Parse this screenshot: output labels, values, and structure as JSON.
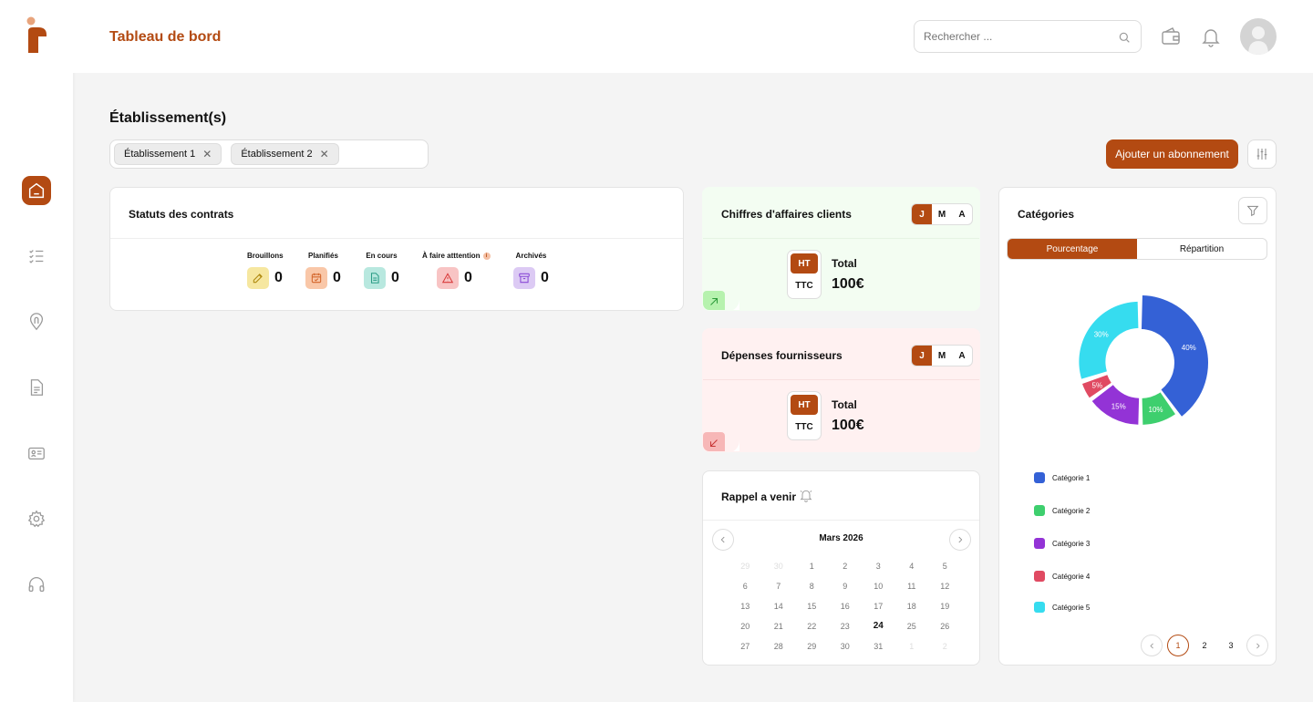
{
  "header": {
    "title": "Tableau de bord",
    "search_placeholder": "Rechercher ..."
  },
  "establishments": {
    "title": "Établissement(s)",
    "chips": [
      {
        "label": "Établissement 1"
      },
      {
        "label": "Établissement 2"
      }
    ]
  },
  "actions": {
    "add_subscription": "Ajouter un abonnement"
  },
  "contract_status": {
    "title": "Statuts des contrats",
    "items": [
      {
        "label": "Brouillons",
        "count": "0",
        "color": "#f6e7a0",
        "icon": "edit-icon"
      },
      {
        "label": "Planifiés",
        "count": "0",
        "color": "#f9c7a8",
        "icon": "calendar-check-icon"
      },
      {
        "label": "En cours",
        "count": "0",
        "color": "#b8e8df",
        "icon": "document-icon"
      },
      {
        "label": "À faire atttention",
        "count": "0",
        "color": "#f8c4c4",
        "icon": "warning-icon"
      },
      {
        "label": "Archivés",
        "count": "0",
        "color": "#dccaf4",
        "icon": "archive-icon"
      }
    ]
  },
  "revenue": {
    "title": "Chiffres d'affaires clients",
    "periods": [
      "J",
      "M",
      "A"
    ],
    "ht": "HT",
    "ttc": "TTC",
    "total_label": "Total",
    "total_value": "100€",
    "bg": "#f3fdf2",
    "accent": "#b6f2ae"
  },
  "expenses": {
    "title": "Dépenses fournisseurs",
    "periods": [
      "J",
      "M",
      "A"
    ],
    "ht": "HT",
    "ttc": "TTC",
    "total_label": "Total",
    "total_value": "100€",
    "bg": "#fff1f1",
    "accent": "#f7b7b7"
  },
  "reminders": {
    "title": "Rappel a venir",
    "month": "Mars 2026",
    "today": "24",
    "days": [
      {
        "d": "29",
        "faded": true
      },
      {
        "d": "30",
        "faded": true
      },
      {
        "d": "1"
      },
      {
        "d": "2"
      },
      {
        "d": "3"
      },
      {
        "d": "4"
      },
      {
        "d": "5"
      },
      {
        "d": "6"
      },
      {
        "d": "7"
      },
      {
        "d": "8"
      },
      {
        "d": "9"
      },
      {
        "d": "10"
      },
      {
        "d": "11"
      },
      {
        "d": "12"
      },
      {
        "d": "13"
      },
      {
        "d": "14"
      },
      {
        "d": "15"
      },
      {
        "d": "16"
      },
      {
        "d": "17"
      },
      {
        "d": "18"
      },
      {
        "d": "19"
      },
      {
        "d": "20"
      },
      {
        "d": "21"
      },
      {
        "d": "22"
      },
      {
        "d": "23"
      },
      {
        "d": "24"
      },
      {
        "d": "25"
      },
      {
        "d": "26"
      },
      {
        "d": "27"
      },
      {
        "d": "28"
      },
      {
        "d": "29"
      },
      {
        "d": "30"
      },
      {
        "d": "31"
      },
      {
        "d": "1",
        "faded": true
      },
      {
        "d": "2",
        "faded": true
      }
    ]
  },
  "categories": {
    "title": "Catégories",
    "tabs": [
      "Pourcentage",
      "Répartition"
    ],
    "pages": [
      "1",
      "2",
      "3"
    ],
    "current_page": "1"
  },
  "chart_data": {
    "type": "pie",
    "variant": "donut",
    "categories": [
      "Catégorie 1",
      "Catégorie 2",
      "Catégorie 3",
      "Catégorie 4",
      "Catégorie 5"
    ],
    "values": [
      40,
      10,
      15,
      5,
      30
    ],
    "labels": [
      "40%",
      "10%",
      "15%",
      "5%",
      "30%"
    ],
    "colors": [
      "#3461d6",
      "#3ecf6e",
      "#9333d6",
      "#e04a62",
      "#36dcef"
    ],
    "legend_position": "bottom-left"
  },
  "colors": {
    "accent": "#b34a12"
  }
}
